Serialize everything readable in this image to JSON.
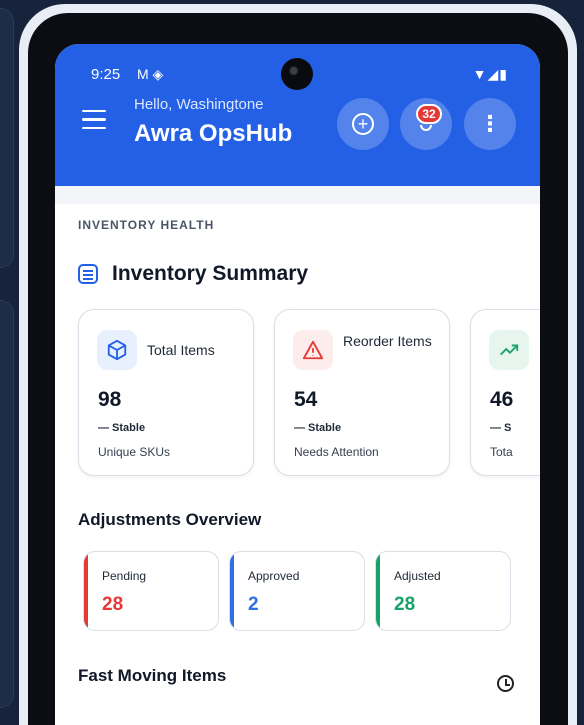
{
  "status_bar": {
    "time": "9:25",
    "left_icons": "M ◈",
    "right_icons": "▼◢▮"
  },
  "header": {
    "greeting": "Hello, Washingtone",
    "title": "Awra OpsHub",
    "notification_count": "32",
    "accent_color": "#2460e6"
  },
  "inventory": {
    "section_label": "INVENTORY HEALTH",
    "title": "Inventory Summary",
    "cards": [
      {
        "title": "Total Items",
        "value": "98",
        "trend": "— Stable",
        "subtitle": "Unique SKUs",
        "icon": "box-icon",
        "color": "#2460e6"
      },
      {
        "title": "Reorder Items",
        "value": "54",
        "trend": "— Stable",
        "subtitle": "Needs Attention",
        "icon": "warning-icon",
        "color": "#e53935"
      },
      {
        "title": "",
        "value": "46",
        "trend": "— S",
        "subtitle": "Tota",
        "icon": "trend-up-icon",
        "color": "#16a36a"
      }
    ]
  },
  "adjustments": {
    "title": "Adjustments Overview",
    "items": [
      {
        "label": "Pending",
        "value": "28",
        "color": "#e53935"
      },
      {
        "label": "Approved",
        "value": "2",
        "color": "#2f6fe4"
      },
      {
        "label": "Adjusted",
        "value": "28",
        "color": "#16a36a"
      }
    ]
  },
  "fast_moving": {
    "title": "Fast Moving Items",
    "icon": "clock-icon"
  }
}
